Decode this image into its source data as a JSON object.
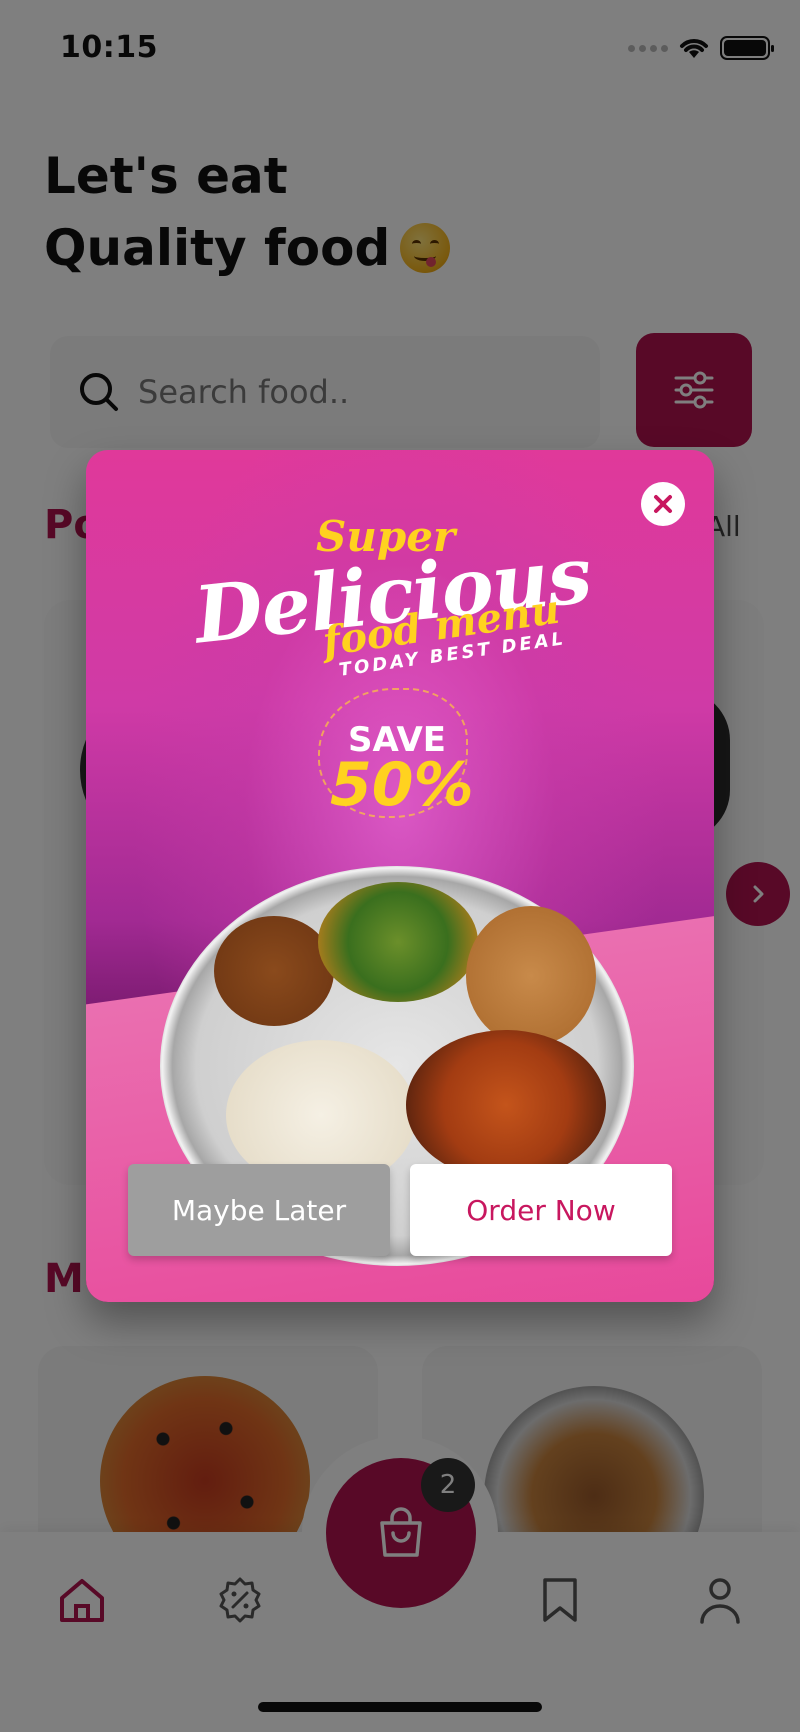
{
  "status_bar": {
    "time": "10:15"
  },
  "header": {
    "title_line1": "Let's eat",
    "title_line2": "Quality food"
  },
  "search": {
    "placeholder": "Search food.."
  },
  "sections": {
    "popular_partial": "Po",
    "see_all_partial": "All",
    "menu_partial": "M"
  },
  "cart": {
    "badge_count": "2"
  },
  "promo": {
    "super_text": "Super",
    "delicious_text": "Delicious",
    "food_menu_text": "food menu",
    "deal_text": "TODAY BEST DEAL",
    "save_text": "SAVE",
    "percent_text": "50%",
    "maybe_later_label": "Maybe Later",
    "order_now_label": "Order Now"
  },
  "colors": {
    "primary": "#b0134f",
    "promo_gradient_top": "#e0399a",
    "promo_gradient_bottom": "#3e0a38",
    "accent_yellow": "#ffd21f"
  },
  "icons": {
    "search": "search-icon",
    "filter": "filter-sliders-icon",
    "close": "close-icon",
    "next": "chevron-right-icon",
    "home": "home-icon",
    "offers": "discount-badge-icon",
    "cart": "shopping-bag-icon",
    "bookmarks": "bookmark-icon",
    "profile": "profile-icon"
  }
}
